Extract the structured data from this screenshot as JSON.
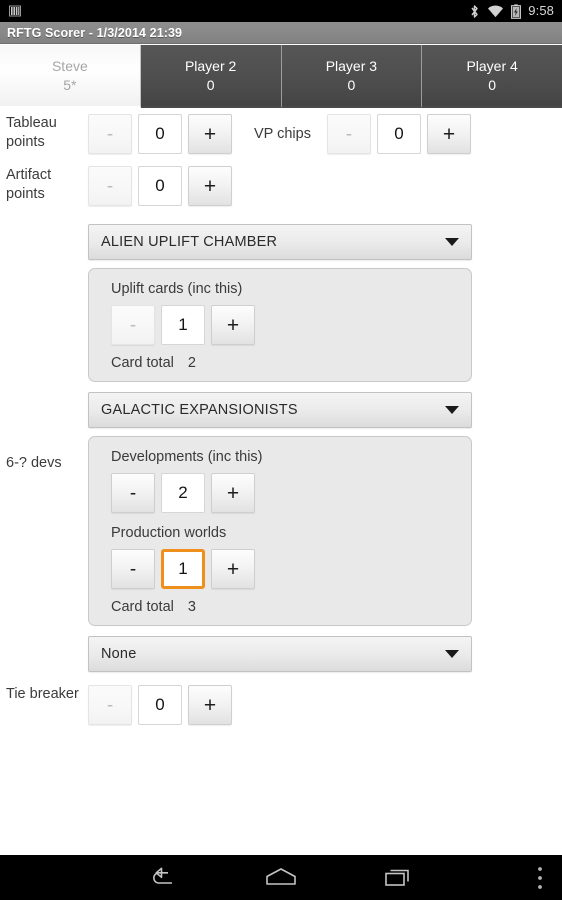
{
  "status_bar": {
    "notification_icon": "bars-icon",
    "bluetooth_icon": "bluetooth-icon",
    "wifi_icon": "wifi-icon",
    "battery_icon": "battery-charging-icon",
    "time": "9:58"
  },
  "title_bar": {
    "title": "RFTG Scorer - 1/3/2014 21:39"
  },
  "tabs": [
    {
      "name": "Steve",
      "score": "5*",
      "active": true
    },
    {
      "name": "Player 2",
      "score": "0",
      "active": false
    },
    {
      "name": "Player 3",
      "score": "0",
      "active": false
    },
    {
      "name": "Player 4",
      "score": "0",
      "active": false
    }
  ],
  "labels": {
    "tableau_points": "Tableau points",
    "artifact_points": "Artifact points",
    "vp_chips": "VP chips",
    "six_devs": "6-? devs",
    "tie_breaker": "Tie breaker",
    "card_total": "Card total"
  },
  "spinners": {
    "tableau_points": {
      "minus": "-",
      "value": "0",
      "plus": "+",
      "minus_disabled": true,
      "focused": false
    },
    "vp_chips": {
      "minus": "-",
      "value": "0",
      "plus": "+",
      "minus_disabled": true,
      "focused": false
    },
    "artifact_points": {
      "minus": "-",
      "value": "0",
      "plus": "+",
      "minus_disabled": true,
      "focused": false
    },
    "uplift_cards": {
      "minus": "-",
      "value": "1",
      "plus": "+",
      "minus_disabled": true,
      "focused": false
    },
    "developments": {
      "minus": "-",
      "value": "2",
      "plus": "+",
      "minus_disabled": false,
      "focused": false
    },
    "production_worlds": {
      "minus": "-",
      "value": "1",
      "plus": "+",
      "minus_disabled": false,
      "focused": true
    },
    "tie_breaker": {
      "minus": "-",
      "value": "0",
      "plus": "+",
      "minus_disabled": true,
      "focused": false
    }
  },
  "card_selects": {
    "first": "ALIEN UPLIFT CHAMBER",
    "second": "GALACTIC EXPANSIONISTS",
    "third": "None"
  },
  "card_panels": {
    "uplift": {
      "field_label": "Uplift cards (inc this)",
      "card_total_label": "Card total",
      "card_total_value": "2"
    },
    "galactic": {
      "field_label_1": "Developments (inc this)",
      "field_label_2": "Production worlds",
      "card_total_label": "Card total",
      "card_total_value": "3"
    }
  },
  "nav_bar": {
    "back": "back-icon",
    "home": "home-icon",
    "recents": "recents-icon",
    "menu": "overflow-menu-icon"
  },
  "colors": {
    "focus_orange": "#ef8f1c",
    "title_gray": "#898989",
    "tab_dark": "#4e4e4e",
    "panel_bg": "#e9e9e9"
  }
}
